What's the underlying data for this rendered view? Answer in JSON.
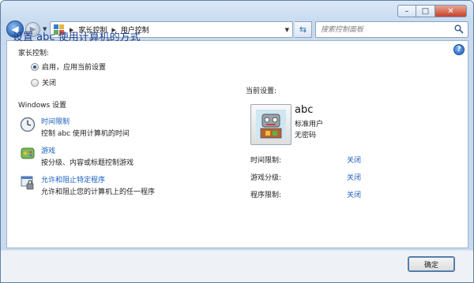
{
  "window": {
    "controls": {
      "minimize": "–",
      "maximize": "□",
      "close": "✕"
    }
  },
  "nav": {
    "breadcrumbs": [
      "家长控制",
      "用户控制"
    ],
    "search_placeholder": "搜索控制面板"
  },
  "main": {
    "title": "设置 abc 使用计算机的方式",
    "parental_label": "家长控制:",
    "options": [
      {
        "label": "启用，应用当前设置",
        "selected": true
      },
      {
        "label": "关闭",
        "selected": false
      }
    ],
    "windows_settings_label": "Windows 设置",
    "tasks": [
      {
        "icon": "clock-icon",
        "link": "时间限制",
        "desc": "控制 abc 使用计算机的时间"
      },
      {
        "icon": "game-controller-icon",
        "link": "游戏",
        "desc": "按分级、内容或标题控制游戏"
      },
      {
        "icon": "program-restrict-icon",
        "link": "允许和阻止特定程序",
        "desc": "允许和阻止您的计算机上的任一程序"
      }
    ]
  },
  "current": {
    "label": "当前设置:",
    "user_name": "abc",
    "user_role": "标准用户",
    "user_password": "无密码",
    "settings": [
      {
        "label": "时间限制:",
        "value": "关闭"
      },
      {
        "label": "游戏分级:",
        "value": "关闭"
      },
      {
        "label": "程序限制:",
        "value": "关闭"
      }
    ]
  },
  "footer": {
    "ok_label": "确定"
  },
  "colors": {
    "link": "#1a5ec0",
    "title": "#1e3f8a",
    "frame": "#c9daee"
  }
}
